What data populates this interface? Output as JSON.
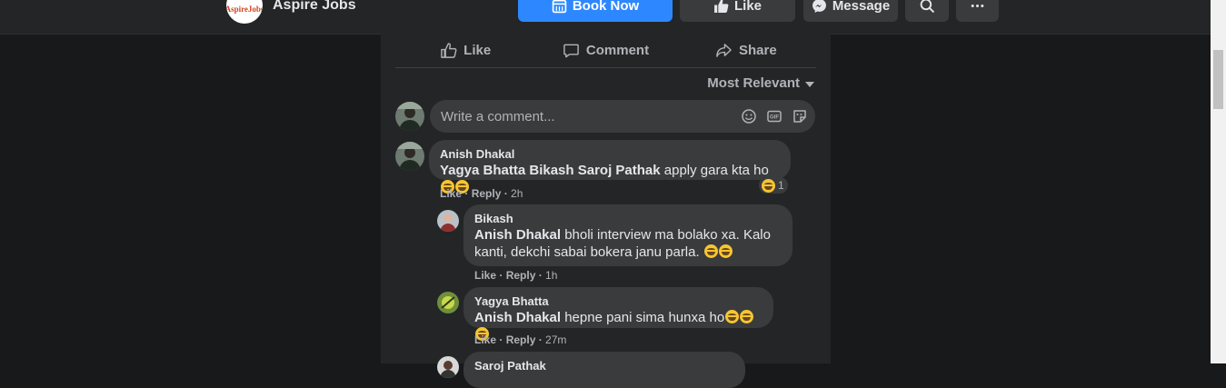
{
  "page": {
    "name": "Aspire Jobs",
    "logo_text": "AspireJobs"
  },
  "topbar": {
    "book_now": "Book Now",
    "like": "Like",
    "message": "Message"
  },
  "actions": {
    "like": "Like",
    "comment": "Comment",
    "share": "Share"
  },
  "sort_label": "Most Relevant",
  "composer": {
    "placeholder": "Write a comment..."
  },
  "comments": [
    {
      "author": "Anish Dhakal",
      "tags": "Yagya Bhatta Bikash Saroj Pathak",
      "text": " apply gara kta ho",
      "like": "Like",
      "reply": "Reply",
      "time": "2h",
      "reaction_count": "1"
    },
    {
      "author": "Bikash",
      "tags": "Anish Dhakal",
      "text": " bholi interview ma bolako xa. Kalo kanti, dekchi sabai bokera janu parla.",
      "like": "Like",
      "reply": "Reply",
      "time": "1h"
    },
    {
      "author": "Yagya Bhatta",
      "tags": "Anish Dhakal",
      "text": " hepne pani sima hunxa ho",
      "like": "Like",
      "reply": "Reply",
      "time": "27m"
    },
    {
      "author": "Saroj Pathak"
    }
  ],
  "colors": {
    "primary": "#2d88ff",
    "surface": "#242526",
    "bubble": "#3a3b3c",
    "background": "#18191a"
  }
}
